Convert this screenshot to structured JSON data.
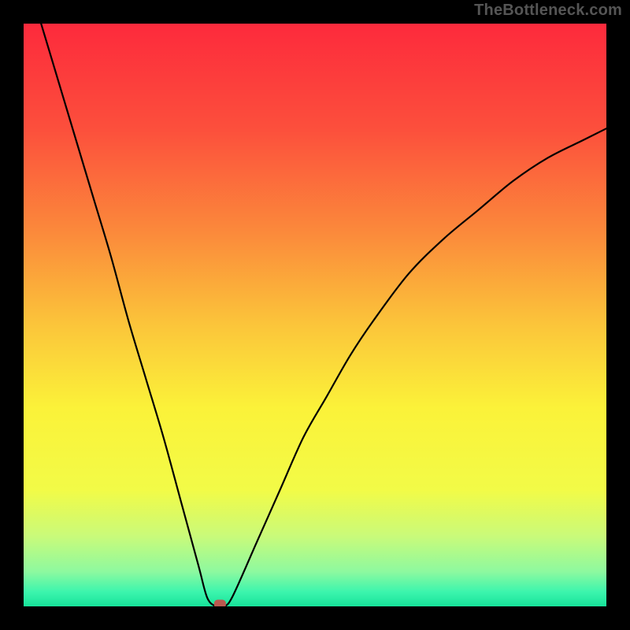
{
  "watermark": "TheBottleneck.com",
  "chart_data": {
    "type": "line",
    "title": "",
    "xlabel": "",
    "ylabel": "",
    "xlim": [
      0,
      1
    ],
    "ylim": [
      0,
      1
    ],
    "grid": false,
    "legend": false,
    "background": {
      "type": "vertical_gradient",
      "stops": [
        {
          "pos": 0.0,
          "color": "#fd2a3c"
        },
        {
          "pos": 0.18,
          "color": "#fc4f3c"
        },
        {
          "pos": 0.36,
          "color": "#fb8a3b"
        },
        {
          "pos": 0.52,
          "color": "#fbc63a"
        },
        {
          "pos": 0.66,
          "color": "#fbf239"
        },
        {
          "pos": 0.8,
          "color": "#f2fb47"
        },
        {
          "pos": 0.88,
          "color": "#c9fa7a"
        },
        {
          "pos": 0.94,
          "color": "#8ef99f"
        },
        {
          "pos": 0.975,
          "color": "#3cf5ad"
        },
        {
          "pos": 1.0,
          "color": "#17e39a"
        }
      ]
    },
    "series": [
      {
        "name": "bottleneck-curve",
        "color": "#000000",
        "x": [
          0.03,
          0.06,
          0.09,
          0.12,
          0.15,
          0.18,
          0.21,
          0.24,
          0.27,
          0.3,
          0.315,
          0.33,
          0.345,
          0.36,
          0.4,
          0.44,
          0.48,
          0.52,
          0.56,
          0.6,
          0.66,
          0.72,
          0.78,
          0.84,
          0.9,
          0.96,
          1.0
        ],
        "y": [
          1.0,
          0.9,
          0.8,
          0.7,
          0.6,
          0.49,
          0.39,
          0.29,
          0.18,
          0.07,
          0.015,
          0.0,
          0.0,
          0.02,
          0.11,
          0.2,
          0.29,
          0.36,
          0.43,
          0.49,
          0.57,
          0.63,
          0.68,
          0.73,
          0.77,
          0.8,
          0.82
        ]
      }
    ],
    "annotations": [
      {
        "name": "min-marker",
        "shape": "rounded_rect",
        "x": 0.337,
        "y": 0.0,
        "color": "#bb594f"
      }
    ]
  }
}
